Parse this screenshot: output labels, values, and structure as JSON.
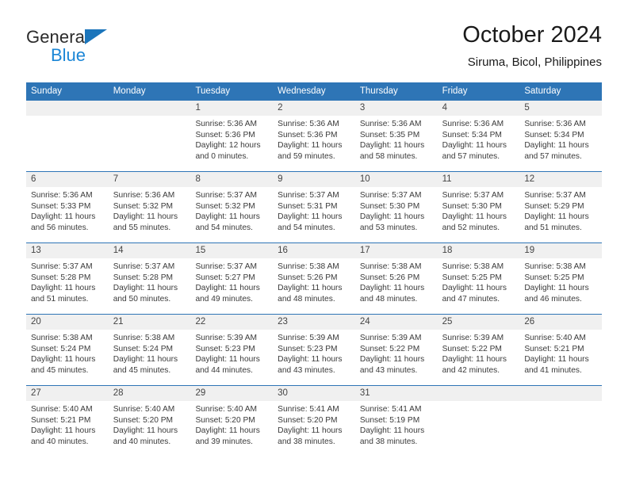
{
  "brand": {
    "name_top": "General",
    "name_bottom": "Blue"
  },
  "header": {
    "title": "October 2024",
    "subtitle": "Siruma, Bicol, Philippines"
  },
  "colors": {
    "header_blue": "#2e75b6",
    "logo_blue": "#1b86d6",
    "daynum_band": "#f0f0f0"
  },
  "weekdays": [
    "Sunday",
    "Monday",
    "Tuesday",
    "Wednesday",
    "Thursday",
    "Friday",
    "Saturday"
  ],
  "weeks": [
    [
      {
        "day": "",
        "lines": []
      },
      {
        "day": "",
        "lines": []
      },
      {
        "day": "1",
        "lines": [
          "Sunrise: 5:36 AM",
          "Sunset: 5:36 PM",
          "Daylight: 12 hours",
          "and 0 minutes."
        ]
      },
      {
        "day": "2",
        "lines": [
          "Sunrise: 5:36 AM",
          "Sunset: 5:36 PM",
          "Daylight: 11 hours",
          "and 59 minutes."
        ]
      },
      {
        "day": "3",
        "lines": [
          "Sunrise: 5:36 AM",
          "Sunset: 5:35 PM",
          "Daylight: 11 hours",
          "and 58 minutes."
        ]
      },
      {
        "day": "4",
        "lines": [
          "Sunrise: 5:36 AM",
          "Sunset: 5:34 PM",
          "Daylight: 11 hours",
          "and 57 minutes."
        ]
      },
      {
        "day": "5",
        "lines": [
          "Sunrise: 5:36 AM",
          "Sunset: 5:34 PM",
          "Daylight: 11 hours",
          "and 57 minutes."
        ]
      }
    ],
    [
      {
        "day": "6",
        "lines": [
          "Sunrise: 5:36 AM",
          "Sunset: 5:33 PM",
          "Daylight: 11 hours",
          "and 56 minutes."
        ]
      },
      {
        "day": "7",
        "lines": [
          "Sunrise: 5:36 AM",
          "Sunset: 5:32 PM",
          "Daylight: 11 hours",
          "and 55 minutes."
        ]
      },
      {
        "day": "8",
        "lines": [
          "Sunrise: 5:37 AM",
          "Sunset: 5:32 PM",
          "Daylight: 11 hours",
          "and 54 minutes."
        ]
      },
      {
        "day": "9",
        "lines": [
          "Sunrise: 5:37 AM",
          "Sunset: 5:31 PM",
          "Daylight: 11 hours",
          "and 54 minutes."
        ]
      },
      {
        "day": "10",
        "lines": [
          "Sunrise: 5:37 AM",
          "Sunset: 5:30 PM",
          "Daylight: 11 hours",
          "and 53 minutes."
        ]
      },
      {
        "day": "11",
        "lines": [
          "Sunrise: 5:37 AM",
          "Sunset: 5:30 PM",
          "Daylight: 11 hours",
          "and 52 minutes."
        ]
      },
      {
        "day": "12",
        "lines": [
          "Sunrise: 5:37 AM",
          "Sunset: 5:29 PM",
          "Daylight: 11 hours",
          "and 51 minutes."
        ]
      }
    ],
    [
      {
        "day": "13",
        "lines": [
          "Sunrise: 5:37 AM",
          "Sunset: 5:28 PM",
          "Daylight: 11 hours",
          "and 51 minutes."
        ]
      },
      {
        "day": "14",
        "lines": [
          "Sunrise: 5:37 AM",
          "Sunset: 5:28 PM",
          "Daylight: 11 hours",
          "and 50 minutes."
        ]
      },
      {
        "day": "15",
        "lines": [
          "Sunrise: 5:37 AM",
          "Sunset: 5:27 PM",
          "Daylight: 11 hours",
          "and 49 minutes."
        ]
      },
      {
        "day": "16",
        "lines": [
          "Sunrise: 5:38 AM",
          "Sunset: 5:26 PM",
          "Daylight: 11 hours",
          "and 48 minutes."
        ]
      },
      {
        "day": "17",
        "lines": [
          "Sunrise: 5:38 AM",
          "Sunset: 5:26 PM",
          "Daylight: 11 hours",
          "and 48 minutes."
        ]
      },
      {
        "day": "18",
        "lines": [
          "Sunrise: 5:38 AM",
          "Sunset: 5:25 PM",
          "Daylight: 11 hours",
          "and 47 minutes."
        ]
      },
      {
        "day": "19",
        "lines": [
          "Sunrise: 5:38 AM",
          "Sunset: 5:25 PM",
          "Daylight: 11 hours",
          "and 46 minutes."
        ]
      }
    ],
    [
      {
        "day": "20",
        "lines": [
          "Sunrise: 5:38 AM",
          "Sunset: 5:24 PM",
          "Daylight: 11 hours",
          "and 45 minutes."
        ]
      },
      {
        "day": "21",
        "lines": [
          "Sunrise: 5:38 AM",
          "Sunset: 5:24 PM",
          "Daylight: 11 hours",
          "and 45 minutes."
        ]
      },
      {
        "day": "22",
        "lines": [
          "Sunrise: 5:39 AM",
          "Sunset: 5:23 PM",
          "Daylight: 11 hours",
          "and 44 minutes."
        ]
      },
      {
        "day": "23",
        "lines": [
          "Sunrise: 5:39 AM",
          "Sunset: 5:23 PM",
          "Daylight: 11 hours",
          "and 43 minutes."
        ]
      },
      {
        "day": "24",
        "lines": [
          "Sunrise: 5:39 AM",
          "Sunset: 5:22 PM",
          "Daylight: 11 hours",
          "and 43 minutes."
        ]
      },
      {
        "day": "25",
        "lines": [
          "Sunrise: 5:39 AM",
          "Sunset: 5:22 PM",
          "Daylight: 11 hours",
          "and 42 minutes."
        ]
      },
      {
        "day": "26",
        "lines": [
          "Sunrise: 5:40 AM",
          "Sunset: 5:21 PM",
          "Daylight: 11 hours",
          "and 41 minutes."
        ]
      }
    ],
    [
      {
        "day": "27",
        "lines": [
          "Sunrise: 5:40 AM",
          "Sunset: 5:21 PM",
          "Daylight: 11 hours",
          "and 40 minutes."
        ]
      },
      {
        "day": "28",
        "lines": [
          "Sunrise: 5:40 AM",
          "Sunset: 5:20 PM",
          "Daylight: 11 hours",
          "and 40 minutes."
        ]
      },
      {
        "day": "29",
        "lines": [
          "Sunrise: 5:40 AM",
          "Sunset: 5:20 PM",
          "Daylight: 11 hours",
          "and 39 minutes."
        ]
      },
      {
        "day": "30",
        "lines": [
          "Sunrise: 5:41 AM",
          "Sunset: 5:20 PM",
          "Daylight: 11 hours",
          "and 38 minutes."
        ]
      },
      {
        "day": "31",
        "lines": [
          "Sunrise: 5:41 AM",
          "Sunset: 5:19 PM",
          "Daylight: 11 hours",
          "and 38 minutes."
        ]
      },
      {
        "day": "",
        "lines": []
      },
      {
        "day": "",
        "lines": []
      }
    ]
  ]
}
